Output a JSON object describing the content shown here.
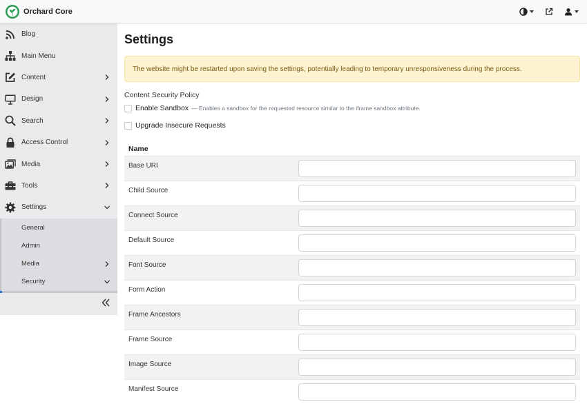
{
  "app": {
    "name": "Orchard Core"
  },
  "topbar": {
    "icons": [
      "theme-toggle-icon",
      "external-link-icon",
      "user-icon"
    ]
  },
  "sidebar": {
    "items": [
      {
        "label": "Blog",
        "icon": "rss-icon",
        "has_chevron": false
      },
      {
        "label": "Main Menu",
        "icon": "sitemap-icon",
        "has_chevron": false
      },
      {
        "label": "Content",
        "icon": "edit-icon",
        "has_chevron": true
      },
      {
        "label": "Design",
        "icon": "monitor-icon",
        "has_chevron": true
      },
      {
        "label": "Search",
        "icon": "search-icon",
        "has_chevron": true
      },
      {
        "label": "Access Control",
        "icon": "lock-icon",
        "has_chevron": true
      },
      {
        "label": "Media",
        "icon": "images-icon",
        "has_chevron": true
      },
      {
        "label": "Tools",
        "icon": "toolbox-icon",
        "has_chevron": true
      },
      {
        "label": "Settings",
        "icon": "gear-icon",
        "expanded": true
      }
    ],
    "settings_sub": [
      {
        "label": "General"
      },
      {
        "label": "Admin"
      },
      {
        "label": "Media",
        "has_chevron": true
      },
      {
        "label": "Security",
        "expanded": true
      }
    ],
    "collapse_icon": "double-chevron-left-icon"
  },
  "main": {
    "title": "Settings",
    "alert": "The website might be restarted upon saving the settings, potentially leading to temporary unresponsiveness during the process.",
    "section_label": "Content Security Policy",
    "enable_sandbox": {
      "label": "Enable Sandbox",
      "hint": "— Enables a sandbox for the requested resource similar to the iframe sandbox attribute.",
      "checked": false
    },
    "upgrade_insecure": {
      "label": "Upgrade Insecure Requests",
      "checked": false
    },
    "table": {
      "header": "Name",
      "rows": [
        {
          "label": "Base URI",
          "value": ""
        },
        {
          "label": "Child Source",
          "value": ""
        },
        {
          "label": "Connect Source",
          "value": ""
        },
        {
          "label": "Default Source",
          "value": ""
        },
        {
          "label": "Font Source",
          "value": ""
        },
        {
          "label": "Form Action",
          "value": ""
        },
        {
          "label": "Frame Ancestors",
          "value": ""
        },
        {
          "label": "Frame Source",
          "value": ""
        },
        {
          "label": "Image Source",
          "value": ""
        },
        {
          "label": "Manifest Source",
          "value": ""
        }
      ]
    }
  },
  "colors": {
    "brand_green": "#2e9d57",
    "alert_bg": "#fdf3d1",
    "alert_text": "#7a5b14",
    "active_indicator": "#2f6fd6"
  }
}
